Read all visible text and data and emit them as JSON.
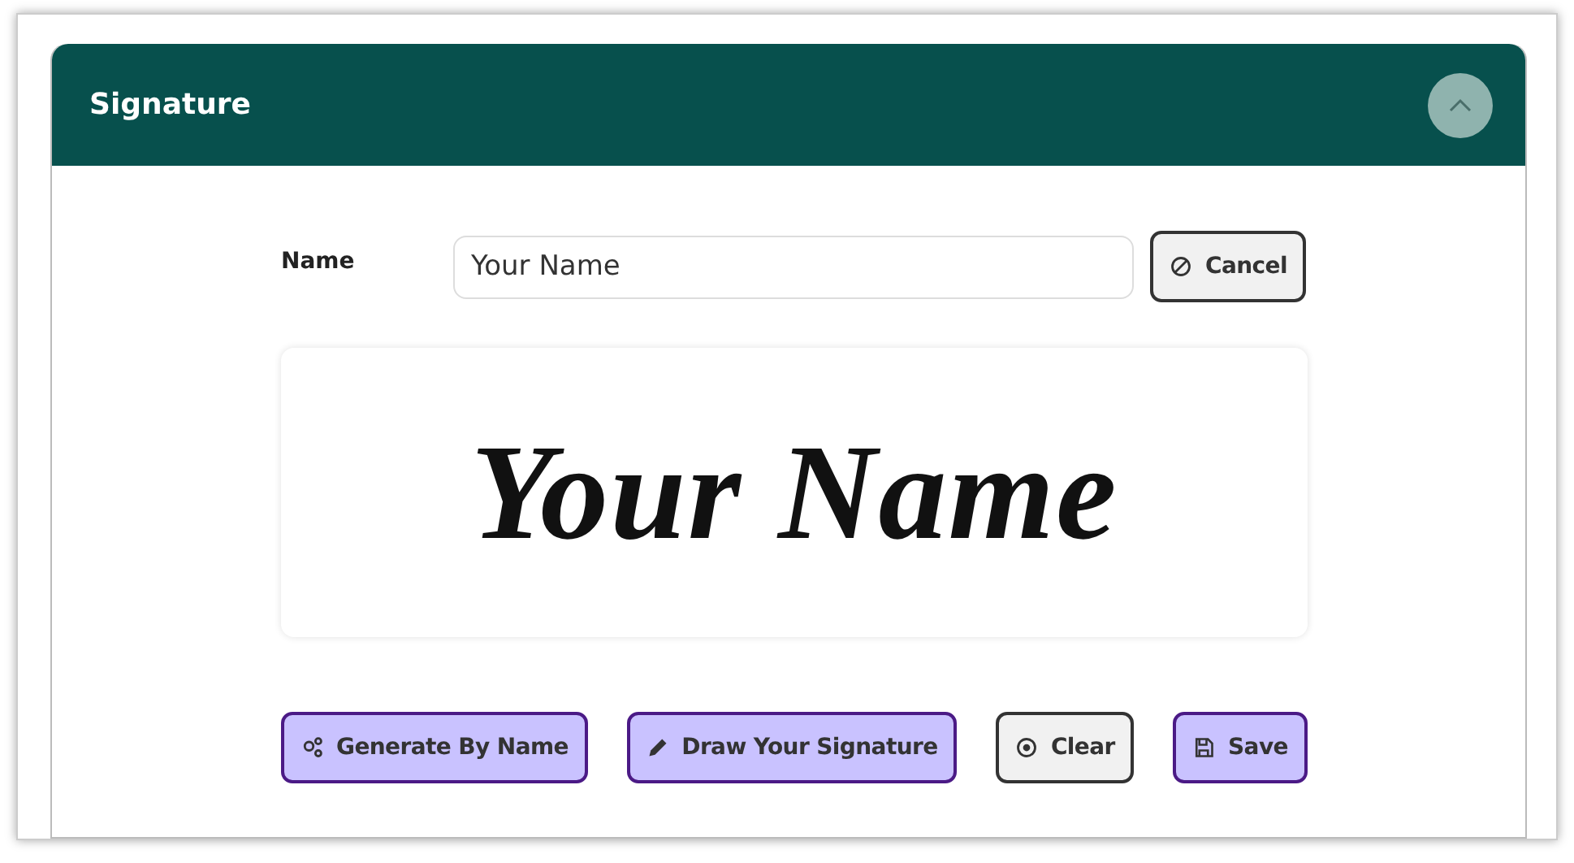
{
  "panel": {
    "title": "Signature",
    "expanded": true
  },
  "name_field": {
    "label": "Name",
    "value": "Your Name"
  },
  "cancel_button": {
    "label": "Cancel"
  },
  "signature_preview": {
    "text": "Your Name"
  },
  "actions": [
    {
      "label": "Generate By Name",
      "kind": "primary"
    },
    {
      "label": "Draw Your Signature",
      "kind": "primary"
    },
    {
      "label": "Clear",
      "kind": "secondary"
    },
    {
      "label": "Save",
      "kind": "primary"
    }
  ]
}
